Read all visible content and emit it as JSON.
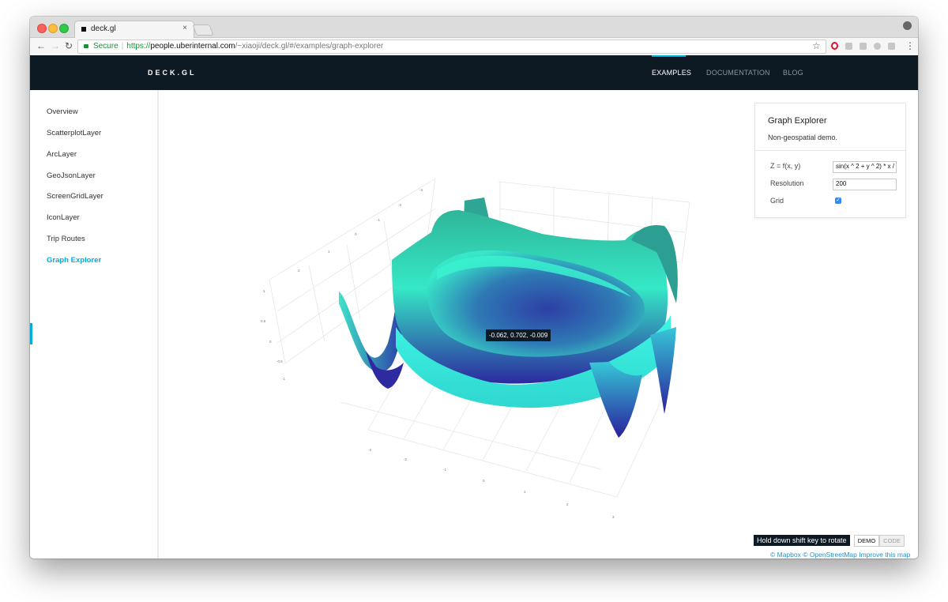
{
  "browser": {
    "tab_title": "deck.gl",
    "tab_close": "×",
    "secure_label": "Secure",
    "url_scheme": "https://",
    "url_host": "people.uberinternal.com",
    "url_path": "/~xiaoji/deck.gl/#/examples/graph-explorer",
    "star": "☆",
    "menu": "⋮"
  },
  "header": {
    "brand": "DECK.GL",
    "nav": [
      {
        "label": "EXAMPLES",
        "active": true
      },
      {
        "label": "DOCUMENTATION",
        "active": false
      },
      {
        "label": "BLOG",
        "active": false
      }
    ]
  },
  "sidebar": {
    "items": [
      {
        "label": "Overview"
      },
      {
        "label": "ScatterplotLayer"
      },
      {
        "label": "ArcLayer"
      },
      {
        "label": "GeoJsonLayer"
      },
      {
        "label": "ScreenGridLayer"
      },
      {
        "label": "IconLayer"
      },
      {
        "label": "Trip Routes"
      },
      {
        "label": "Graph Explorer",
        "active": true
      }
    ]
  },
  "panel": {
    "title": "Graph Explorer",
    "description": "Non-geospatial demo.",
    "controls": {
      "function_label": "Z = f(x, y)",
      "function_value": "sin(x ^ 2 + y ^ 2) * x /",
      "resolution_label": "Resolution",
      "resolution_value": "200",
      "grid_label": "Grid",
      "grid_checked": true
    }
  },
  "plot": {
    "tooltip": "-0.062, 0.702, -0.009",
    "axis_ticks_back": [
      "-3",
      "-2",
      "-1",
      "0",
      "1",
      "2",
      "3"
    ],
    "axis_ticks_z": [
      "1",
      "0.5",
      "0",
      "-0.5",
      "-1"
    ],
    "axis_ticks_front": [
      "-3",
      "-2",
      "-1",
      "0",
      "1",
      "2",
      "3"
    ]
  },
  "footer": {
    "hint": "Hold down shift key to rotate",
    "demo_label": "DEMO",
    "code_label": "CODE",
    "attribution": "© Mapbox © OpenStreetMap Improve this map"
  },
  "colors": {
    "nav_bg": "#0d1923",
    "accent": "#00aedb",
    "surface_light": "#3ef5d6",
    "surface_mid": "#2fb6a6",
    "surface_dark": "#2a1e9b"
  }
}
